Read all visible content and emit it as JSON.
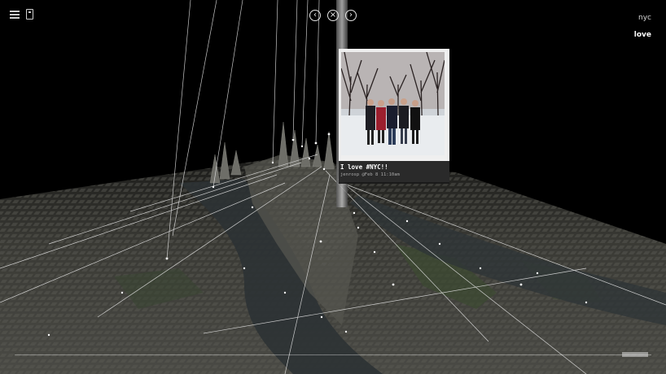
{
  "header": {
    "menu_icon": "hamburger-menu-icon",
    "device_icon": "phone-icon",
    "nav": {
      "prev_icon": "chevron-left-icon",
      "close_icon": "close-icon",
      "next_icon": "chevron-right-icon",
      "prev_glyph": "‹",
      "close_glyph": "×",
      "next_glyph": "›"
    }
  },
  "filters": {
    "city": "nyc",
    "keyword": "love"
  },
  "post": {
    "caption": "I love #NYC!!",
    "meta": "jenrosp @Feb 8 11:10am"
  },
  "colors": {
    "background": "#000000",
    "text": "#ffffff",
    "map_tint": "#3a3a34",
    "water": "#2f3538"
  },
  "timeline": {
    "position": 0.96
  }
}
